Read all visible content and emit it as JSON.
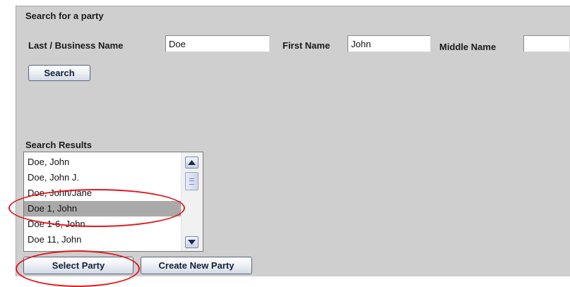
{
  "search_section": {
    "title": "Search for a party",
    "last_name_label": "Last / Business Name",
    "last_name_value": "Doe",
    "first_name_label": "First Name",
    "first_name_value": "John",
    "middle_name_label": "Middle Name",
    "middle_name_value": "",
    "search_button": "Search"
  },
  "results": {
    "title": "Search Results",
    "items": [
      "Doe, John",
      "Doe, John J.",
      "Doe, John/Jane",
      "Doe 1, John",
      "Doe 1-6, John",
      "Doe 11, John"
    ],
    "selected": "Doe 1, John"
  },
  "actions": {
    "select_party": "Select Party",
    "create_new_party": "Create New Party"
  },
  "colors": {
    "annotation": "#e0181f",
    "selection": "#a9a9a9",
    "panel_background": "#cfcfcf"
  },
  "icons": {
    "scroll_up": "scroll-up-arrow-icon",
    "scroll_down": "scroll-down-arrow-icon"
  }
}
